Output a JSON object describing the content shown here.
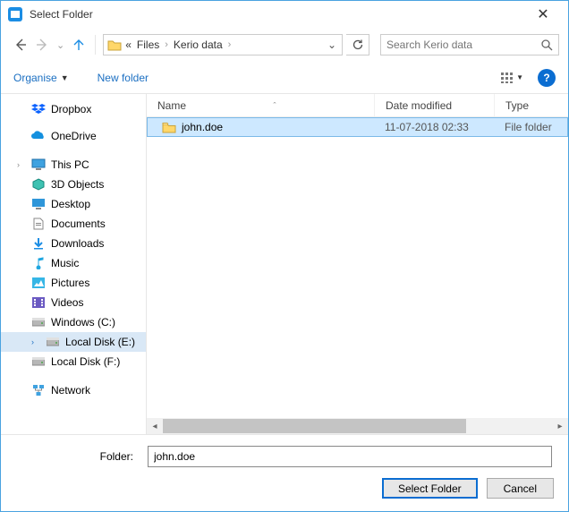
{
  "window": {
    "title": "Select Folder"
  },
  "address": {
    "prefix": "«",
    "crumbs": [
      "Files",
      "Kerio data"
    ]
  },
  "search": {
    "placeholder": "Search Kerio data"
  },
  "toolbar": {
    "organise": "Organise",
    "newfolder": "New folder"
  },
  "tree": {
    "quick": [
      {
        "label": "Dropbox",
        "icon": "dropbox"
      },
      {
        "label": "OneDrive",
        "icon": "onedrive"
      }
    ],
    "pc_label": "This PC",
    "pc_children": [
      {
        "label": "3D Objects",
        "icon": "3d"
      },
      {
        "label": "Desktop",
        "icon": "desktop"
      },
      {
        "label": "Documents",
        "icon": "documents"
      },
      {
        "label": "Downloads",
        "icon": "downloads"
      },
      {
        "label": "Music",
        "icon": "music"
      },
      {
        "label": "Pictures",
        "icon": "pictures"
      },
      {
        "label": "Videos",
        "icon": "videos"
      },
      {
        "label": "Windows (C:)",
        "icon": "drive"
      },
      {
        "label": "Local Disk (E:)",
        "icon": "drive",
        "selected": true
      },
      {
        "label": "Local Disk (F:)",
        "icon": "drive"
      }
    ],
    "network_label": "Network"
  },
  "columns": {
    "name": "Name",
    "date": "Date modified",
    "type": "Type"
  },
  "rows": [
    {
      "name": "john.doe",
      "date": "11-07-2018 02:33",
      "type": "File folder",
      "selected": true
    }
  ],
  "footer": {
    "label": "Folder:",
    "value": "john.doe",
    "select": "Select Folder",
    "cancel": "Cancel"
  }
}
